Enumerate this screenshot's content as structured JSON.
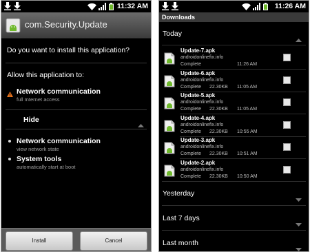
{
  "left": {
    "status_time": "11:32 AM",
    "app_title": "com.Security.Update",
    "question": "Do you want to install this application?",
    "allow": "Allow this application to:",
    "warning_permission": {
      "title": "Network communication",
      "subtitle": "full Internet access"
    },
    "hide_label": "Hide",
    "permissions": [
      {
        "title": "Network communication",
        "subtitle": "view network state"
      },
      {
        "title": "System tools",
        "subtitle": "automatically start at boot"
      }
    ],
    "install_label": "Install",
    "cancel_label": "Cancel"
  },
  "right": {
    "status_time": "11:26 AM",
    "header": "Downloads",
    "today_label": "Today",
    "items": [
      {
        "name": "Update-7.apk",
        "site": "androidonlinefix.info",
        "status": "Complete",
        "size": "",
        "time": "11:26 AM"
      },
      {
        "name": "Update-6.apk",
        "site": "androidonlinefix.info",
        "status": "Complete",
        "size": "22.30KB",
        "time": "11:05 AM"
      },
      {
        "name": "Update-5.apk",
        "site": "androidonlinefix.info",
        "status": "Complete",
        "size": "22.30KB",
        "time": "11:05 AM"
      },
      {
        "name": "Update-4.apk",
        "site": "androidonlinefix.info",
        "status": "Complete",
        "size": "22.30KB",
        "time": "10:55 AM"
      },
      {
        "name": "Update-3.apk",
        "site": "androidonlinefix.info",
        "status": "Complete",
        "size": "22.30KB",
        "time": "10:51 AM"
      },
      {
        "name": "Update-2.apk",
        "site": "androidonlinefix.info",
        "status": "Complete",
        "size": "22.30KB",
        "time": "10:50 AM"
      }
    ],
    "groups": [
      "Yesterday",
      "Last 7 days",
      "Last month"
    ]
  },
  "colors": {
    "accent_green": "#6fb92c",
    "warning_orange": "#e8731c"
  }
}
